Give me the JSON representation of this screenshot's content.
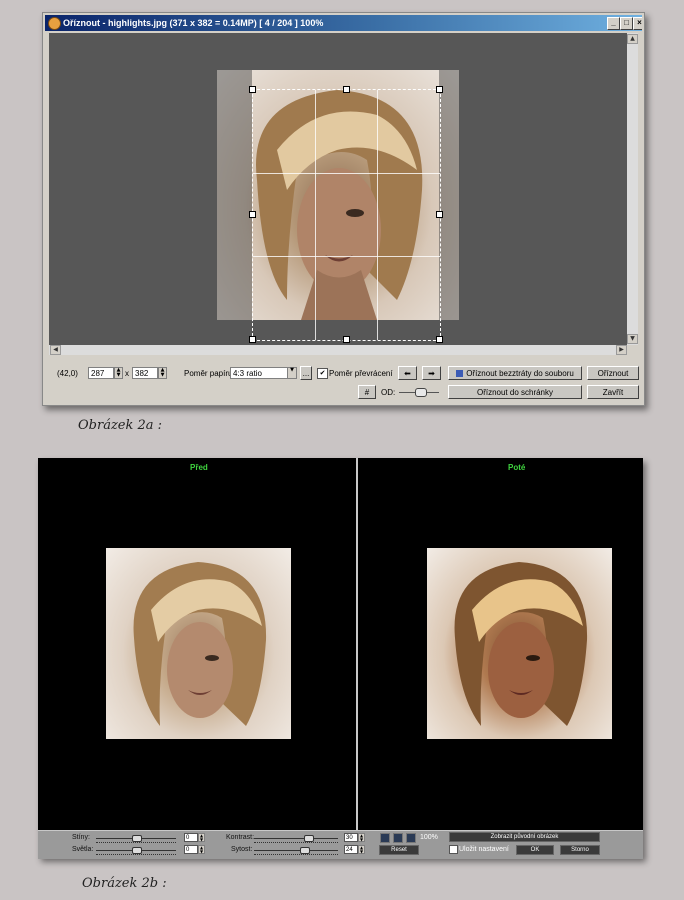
{
  "window1": {
    "title": "Oříznout - highlights.jpg (371 x 382 = 0.14MP) [ 4 / 204 ] 100%",
    "controls": {
      "minimize": "_",
      "maximize": "□",
      "close": "×"
    },
    "coords": "(42,0)",
    "width_value": "287",
    "times": "x",
    "height_value": "382",
    "ratio_label": "Poměr papíru:",
    "ratio_value": "4:3 ratio",
    "more_button": "...",
    "flip_ratio_label": "Poměr převrácení",
    "crop_lossless_label": "Oříznout bezztráty do souboru",
    "crop_label": "Oříznout",
    "crop_clipboard_label": "Oříznout do schránky",
    "close_label": "Zavřít",
    "od_label": "OD:"
  },
  "caption1": "Obrázek 2a :",
  "window2": {
    "before_title": "Před",
    "after_title": "Poté",
    "shadows_label": "Stíny:",
    "shadows_value": "0",
    "highlights_label": "Světla:",
    "highlights_value": "0",
    "contrast_label": "Kontrast:",
    "contrast_value": "30",
    "saturation_label": "Sytost:",
    "saturation_value": "24",
    "reset_label": "Reset",
    "zoom_label": "100%",
    "show_original_label": "Zobrazit původní obrázek",
    "save_settings_label": "Uložit nastavení",
    "ok_label": "OK",
    "cancel_label": "Storno"
  },
  "caption2": "Obrázek 2b :"
}
